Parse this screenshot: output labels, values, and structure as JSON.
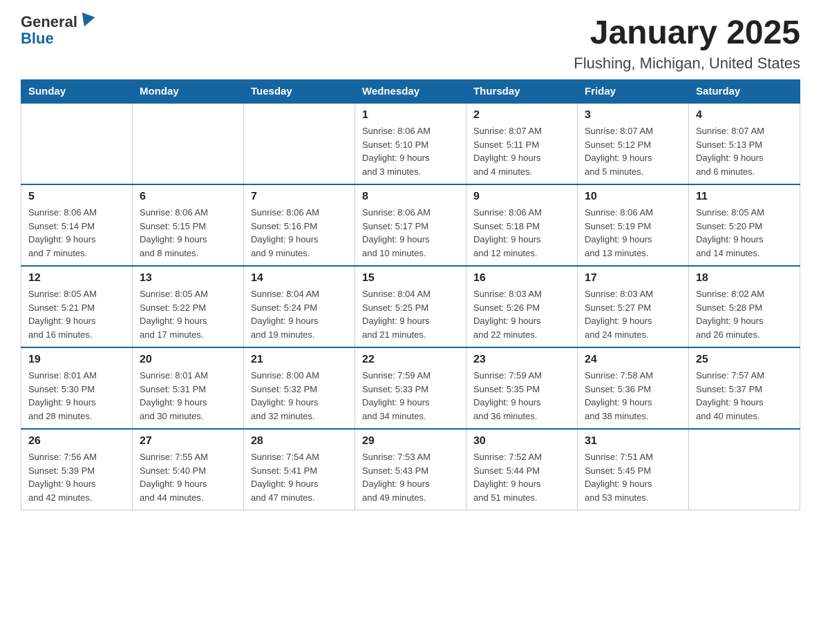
{
  "header": {
    "logo_text1": "General",
    "logo_text2": "Blue",
    "title": "January 2025",
    "subtitle": "Flushing, Michigan, United States"
  },
  "days_of_week": [
    "Sunday",
    "Monday",
    "Tuesday",
    "Wednesday",
    "Thursday",
    "Friday",
    "Saturday"
  ],
  "weeks": [
    [
      {
        "day": "",
        "info": ""
      },
      {
        "day": "",
        "info": ""
      },
      {
        "day": "",
        "info": ""
      },
      {
        "day": "1",
        "info": "Sunrise: 8:06 AM\nSunset: 5:10 PM\nDaylight: 9 hours\nand 3 minutes."
      },
      {
        "day": "2",
        "info": "Sunrise: 8:07 AM\nSunset: 5:11 PM\nDaylight: 9 hours\nand 4 minutes."
      },
      {
        "day": "3",
        "info": "Sunrise: 8:07 AM\nSunset: 5:12 PM\nDaylight: 9 hours\nand 5 minutes."
      },
      {
        "day": "4",
        "info": "Sunrise: 8:07 AM\nSunset: 5:13 PM\nDaylight: 9 hours\nand 6 minutes."
      }
    ],
    [
      {
        "day": "5",
        "info": "Sunrise: 8:06 AM\nSunset: 5:14 PM\nDaylight: 9 hours\nand 7 minutes."
      },
      {
        "day": "6",
        "info": "Sunrise: 8:06 AM\nSunset: 5:15 PM\nDaylight: 9 hours\nand 8 minutes."
      },
      {
        "day": "7",
        "info": "Sunrise: 8:06 AM\nSunset: 5:16 PM\nDaylight: 9 hours\nand 9 minutes."
      },
      {
        "day": "8",
        "info": "Sunrise: 8:06 AM\nSunset: 5:17 PM\nDaylight: 9 hours\nand 10 minutes."
      },
      {
        "day": "9",
        "info": "Sunrise: 8:06 AM\nSunset: 5:18 PM\nDaylight: 9 hours\nand 12 minutes."
      },
      {
        "day": "10",
        "info": "Sunrise: 8:06 AM\nSunset: 5:19 PM\nDaylight: 9 hours\nand 13 minutes."
      },
      {
        "day": "11",
        "info": "Sunrise: 8:05 AM\nSunset: 5:20 PM\nDaylight: 9 hours\nand 14 minutes."
      }
    ],
    [
      {
        "day": "12",
        "info": "Sunrise: 8:05 AM\nSunset: 5:21 PM\nDaylight: 9 hours\nand 16 minutes."
      },
      {
        "day": "13",
        "info": "Sunrise: 8:05 AM\nSunset: 5:22 PM\nDaylight: 9 hours\nand 17 minutes."
      },
      {
        "day": "14",
        "info": "Sunrise: 8:04 AM\nSunset: 5:24 PM\nDaylight: 9 hours\nand 19 minutes."
      },
      {
        "day": "15",
        "info": "Sunrise: 8:04 AM\nSunset: 5:25 PM\nDaylight: 9 hours\nand 21 minutes."
      },
      {
        "day": "16",
        "info": "Sunrise: 8:03 AM\nSunset: 5:26 PM\nDaylight: 9 hours\nand 22 minutes."
      },
      {
        "day": "17",
        "info": "Sunrise: 8:03 AM\nSunset: 5:27 PM\nDaylight: 9 hours\nand 24 minutes."
      },
      {
        "day": "18",
        "info": "Sunrise: 8:02 AM\nSunset: 5:28 PM\nDaylight: 9 hours\nand 26 minutes."
      }
    ],
    [
      {
        "day": "19",
        "info": "Sunrise: 8:01 AM\nSunset: 5:30 PM\nDaylight: 9 hours\nand 28 minutes."
      },
      {
        "day": "20",
        "info": "Sunrise: 8:01 AM\nSunset: 5:31 PM\nDaylight: 9 hours\nand 30 minutes."
      },
      {
        "day": "21",
        "info": "Sunrise: 8:00 AM\nSunset: 5:32 PM\nDaylight: 9 hours\nand 32 minutes."
      },
      {
        "day": "22",
        "info": "Sunrise: 7:59 AM\nSunset: 5:33 PM\nDaylight: 9 hours\nand 34 minutes."
      },
      {
        "day": "23",
        "info": "Sunrise: 7:59 AM\nSunset: 5:35 PM\nDaylight: 9 hours\nand 36 minutes."
      },
      {
        "day": "24",
        "info": "Sunrise: 7:58 AM\nSunset: 5:36 PM\nDaylight: 9 hours\nand 38 minutes."
      },
      {
        "day": "25",
        "info": "Sunrise: 7:57 AM\nSunset: 5:37 PM\nDaylight: 9 hours\nand 40 minutes."
      }
    ],
    [
      {
        "day": "26",
        "info": "Sunrise: 7:56 AM\nSunset: 5:39 PM\nDaylight: 9 hours\nand 42 minutes."
      },
      {
        "day": "27",
        "info": "Sunrise: 7:55 AM\nSunset: 5:40 PM\nDaylight: 9 hours\nand 44 minutes."
      },
      {
        "day": "28",
        "info": "Sunrise: 7:54 AM\nSunset: 5:41 PM\nDaylight: 9 hours\nand 47 minutes."
      },
      {
        "day": "29",
        "info": "Sunrise: 7:53 AM\nSunset: 5:43 PM\nDaylight: 9 hours\nand 49 minutes."
      },
      {
        "day": "30",
        "info": "Sunrise: 7:52 AM\nSunset: 5:44 PM\nDaylight: 9 hours\nand 51 minutes."
      },
      {
        "day": "31",
        "info": "Sunrise: 7:51 AM\nSunset: 5:45 PM\nDaylight: 9 hours\nand 53 minutes."
      },
      {
        "day": "",
        "info": ""
      }
    ]
  ]
}
